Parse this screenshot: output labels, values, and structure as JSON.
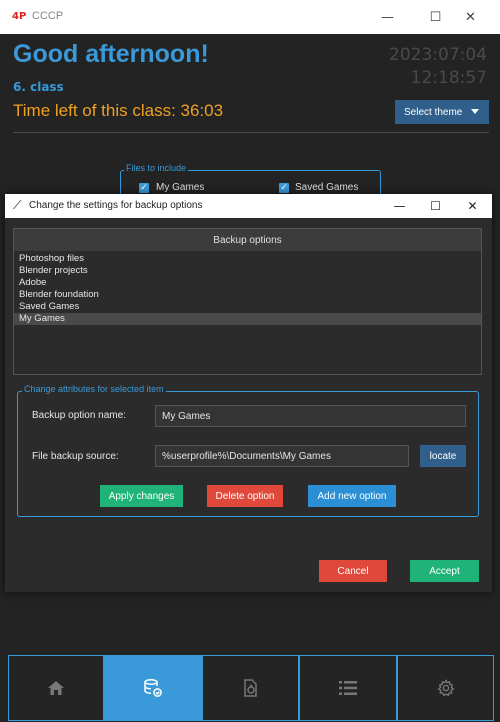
{
  "main_window": {
    "app_icon": "4P",
    "title": "CCCP",
    "controls": {
      "minimize": "—",
      "maximize": "☐",
      "close": "✕"
    }
  },
  "header": {
    "greeting": "Good afternoon!",
    "date": "2023:07:04",
    "time": "12:18:57",
    "class_label": "6. class",
    "time_left": "Time left of this class: 36:03",
    "theme_button": "Select theme"
  },
  "files_to_include": {
    "legend": "Files to include",
    "items": [
      {
        "label": "My Games",
        "checked": true
      },
      {
        "label": "Saved Games",
        "checked": true
      }
    ]
  },
  "dialog": {
    "title": "Change the settings for backup options",
    "controls": {
      "minimize": "—",
      "maximize": "☐",
      "close": "✕"
    },
    "options_header": "Backup options",
    "options": [
      "Photoshop files",
      "Blender projects",
      "Adobe",
      "Blender foundation",
      "Saved Games",
      "My Games"
    ],
    "selected_option": "My Games",
    "attributes": {
      "legend": "Change attributes for selected item",
      "name_label": "Backup option name:",
      "name_value": "My Games",
      "source_label": "File backup source:",
      "source_value": "%userprofile%\\Documents\\My Games",
      "locate_button": "locate",
      "apply_button": "Apply changes",
      "delete_button": "Delete option",
      "add_button": "Add new option"
    },
    "cancel_button": "Cancel",
    "accept_button": "Accept"
  },
  "bottom_nav": [
    {
      "name": "home",
      "icon": "home-icon",
      "active": false
    },
    {
      "name": "backup",
      "icon": "database-sync-icon",
      "active": true
    },
    {
      "name": "restore",
      "icon": "file-sync-icon",
      "active": false
    },
    {
      "name": "list",
      "icon": "list-icon",
      "active": false
    },
    {
      "name": "settings",
      "icon": "gear-icon",
      "active": false
    }
  ],
  "colors": {
    "accent_blue": "#3a9ad9",
    "warning_orange": "#f0a020",
    "success_green": "#1fb37a",
    "danger_red": "#e0483c",
    "background": "#232323"
  }
}
